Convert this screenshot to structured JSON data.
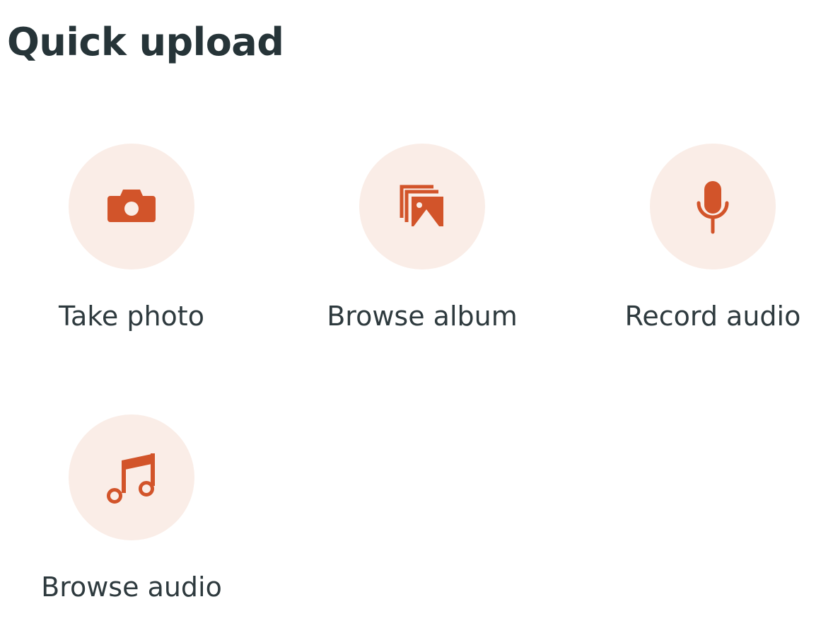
{
  "header": {
    "title": "Quick upload"
  },
  "colors": {
    "accent": "#D2542A",
    "circle_bg": "#FAEDE7",
    "text": "#2E3A3E"
  },
  "actions": [
    {
      "label": "Take photo",
      "icon": "camera-icon"
    },
    {
      "label": "Browse album",
      "icon": "photo-album-icon"
    },
    {
      "label": "Record audio",
      "icon": "microphone-icon"
    },
    {
      "label": "Browse audio",
      "icon": "music-note-icon"
    }
  ]
}
